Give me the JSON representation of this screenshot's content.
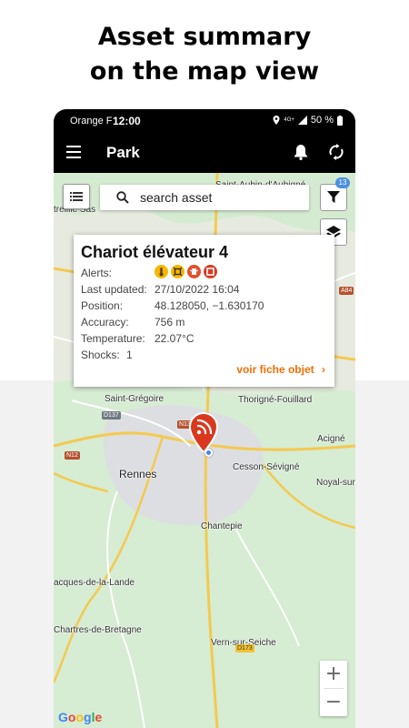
{
  "headline": {
    "line1": "Asset summary",
    "line2": "on the map view"
  },
  "status_bar": {
    "carrier": "Orange F",
    "time": "12:00",
    "network": "4G+",
    "battery": "50 %"
  },
  "app_bar": {
    "title": "Park",
    "icons": [
      "menu-icon",
      "bell-icon",
      "sync-icon"
    ]
  },
  "search": {
    "placeholder": "search asset"
  },
  "filter": {
    "badge_count": "13"
  },
  "asset_card": {
    "name": "Chariot élévateur 4",
    "rows": [
      {
        "label": "Alerts:",
        "value": ""
      },
      {
        "label": "Last updated:",
        "value": "27/10/2022 16:04"
      },
      {
        "label": "Position:",
        "value": "48.128050, −1.630170"
      },
      {
        "label": "Accuracy:",
        "value": "756 m"
      },
      {
        "label": "Temperature:",
        "value": "22.07°C"
      },
      {
        "label": "Shocks:",
        "value": "1"
      }
    ],
    "alert_icons": [
      {
        "name": "temperature-alert-icon",
        "color": "#f5b800"
      },
      {
        "name": "movement-alert-icon",
        "color": "#f5b800"
      },
      {
        "name": "shock-alert-icon",
        "color": "#e0502a"
      },
      {
        "name": "zone-alert-icon",
        "color": "#d9381e"
      }
    ],
    "link": "voir fiche objet"
  },
  "map_labels": {
    "saint_aubin": "Saint-Aubin-d'Aubigné",
    "saint_gregoire": "Saint-Grégoire",
    "thorigne": "Thorigné-Fouillard",
    "rennes": "Rennes",
    "cesson": "Cesson-Sévigné",
    "acigne": "Acigné",
    "noyal": "Noyal-sur",
    "chantepie": "Chantepie",
    "bruz_lande": "acques-de-la-Lande",
    "chartres": "Chartres-de-Bretagne",
    "vern": "Vern-sur-Seiche",
    "left_top": "treillie Sas",
    "road_d137": "D137",
    "road_n12": "N12",
    "road_n136": "N13",
    "road_a84": "A84",
    "road_d173": "D173",
    "google": "Google"
  },
  "colors": {
    "accent": "#f16e00",
    "marker": "#d9381e",
    "water": "#4285f4",
    "badge": "#4a90e2"
  }
}
